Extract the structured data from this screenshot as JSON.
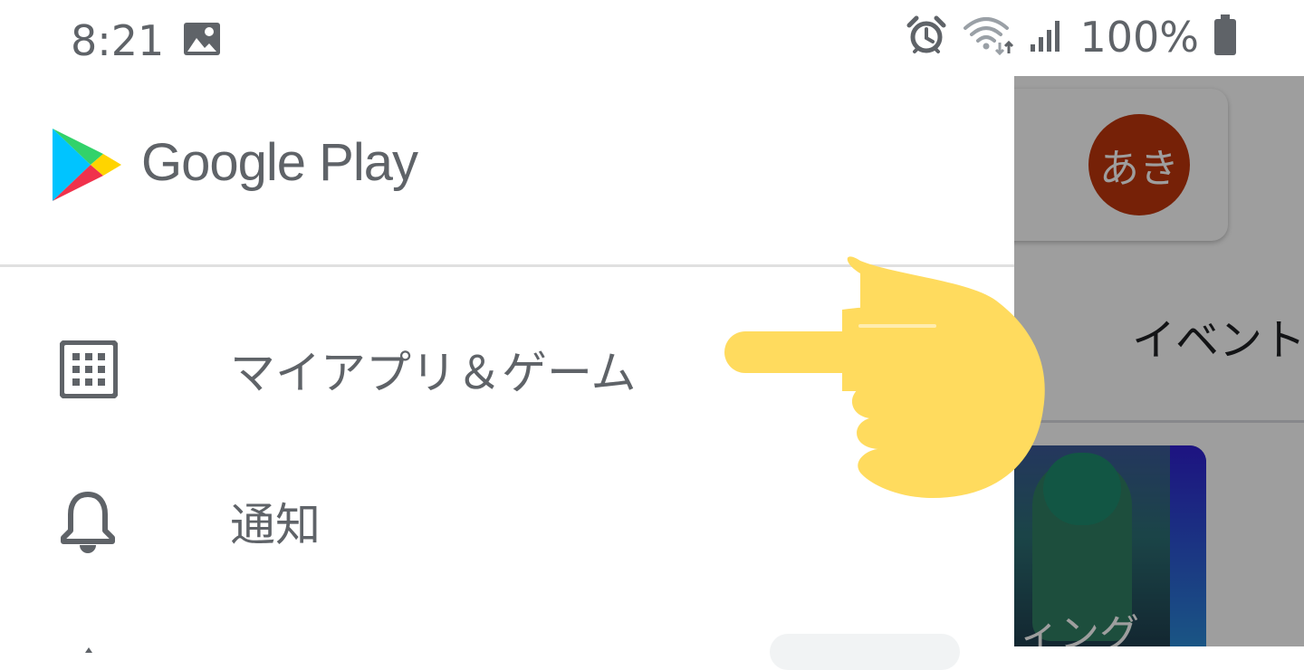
{
  "status_bar": {
    "time": "8:21",
    "battery": "100%",
    "icons": [
      "gallery-icon",
      "alarm-icon",
      "wifi-icon",
      "signal-icon",
      "battery-icon"
    ]
  },
  "drawer": {
    "brand": "Google Play",
    "menu_items": [
      {
        "label": "マイアプリ＆ゲーム",
        "icon": "grid-apps-icon"
      },
      {
        "label": "通知",
        "icon": "bell-icon"
      }
    ]
  },
  "background": {
    "avatar_text": "あき",
    "tab_label": "イベント",
    "game_title": "ィング"
  },
  "overlay": {
    "icon": "pointing-hand-icon",
    "color": "#ffdb5e"
  },
  "colors": {
    "text_gray": "#5f6368",
    "avatar": "#bf360c"
  }
}
